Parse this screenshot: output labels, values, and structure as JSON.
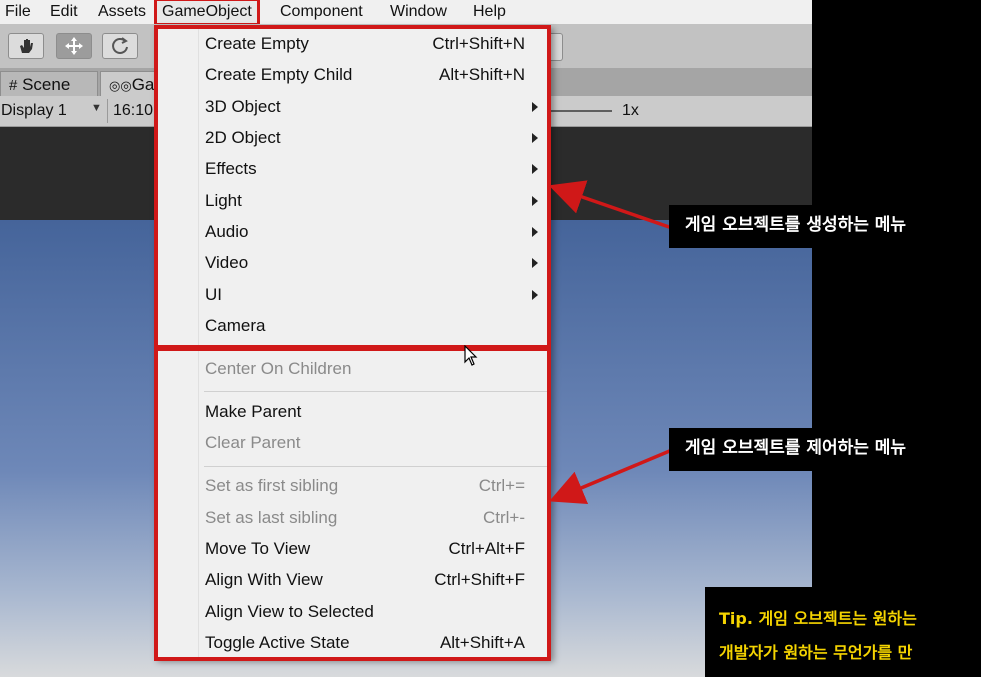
{
  "menubar": {
    "items": [
      "File",
      "Edit",
      "Assets",
      "GameObject",
      "Component",
      "Window",
      "Help"
    ],
    "active": "GameObject"
  },
  "tabs": {
    "scene": "Scene",
    "game": "Ga"
  },
  "gamebar": {
    "display": "Display 1",
    "aspect": "16:10",
    "scale": "1x"
  },
  "menu": {
    "items": [
      {
        "label": "Create Empty",
        "shortcut": "Ctrl+Shift+N"
      },
      {
        "label": "Create Empty Child",
        "shortcut": "Alt+Shift+N"
      },
      {
        "label": "3D Object"
      },
      {
        "label": "2D Object"
      },
      {
        "label": "Effects"
      },
      {
        "label": "Light"
      },
      {
        "label": "Audio"
      },
      {
        "label": "Video"
      },
      {
        "label": "UI"
      },
      {
        "label": "Camera"
      },
      {
        "label": "Center On Children"
      },
      {
        "label": "Make Parent"
      },
      {
        "label": "Clear Parent"
      },
      {
        "label": "Set as first sibling",
        "shortcut": "Ctrl+="
      },
      {
        "label": "Set as last sibling",
        "shortcut": "Ctrl+-"
      },
      {
        "label": "Move To View",
        "shortcut": "Ctrl+Alt+F"
      },
      {
        "label": "Align With View",
        "shortcut": "Ctrl+Shift+F"
      },
      {
        "label": "Align View to Selected"
      },
      {
        "label": "Toggle Active State",
        "shortcut": "Alt+Shift+A"
      }
    ]
  },
  "callouts": {
    "create": "게임 오브젝트를 생성하는 메뉴",
    "control": "게임 오브젝트를 제어하는 메뉴"
  },
  "tip": {
    "line1": "Tip. 게임 오브젝트는 원하는",
    "line2": "개발자가 원하는 무언가를 만"
  },
  "colors": {
    "highlight": "#d01818",
    "tip_text": "#f5d400"
  }
}
